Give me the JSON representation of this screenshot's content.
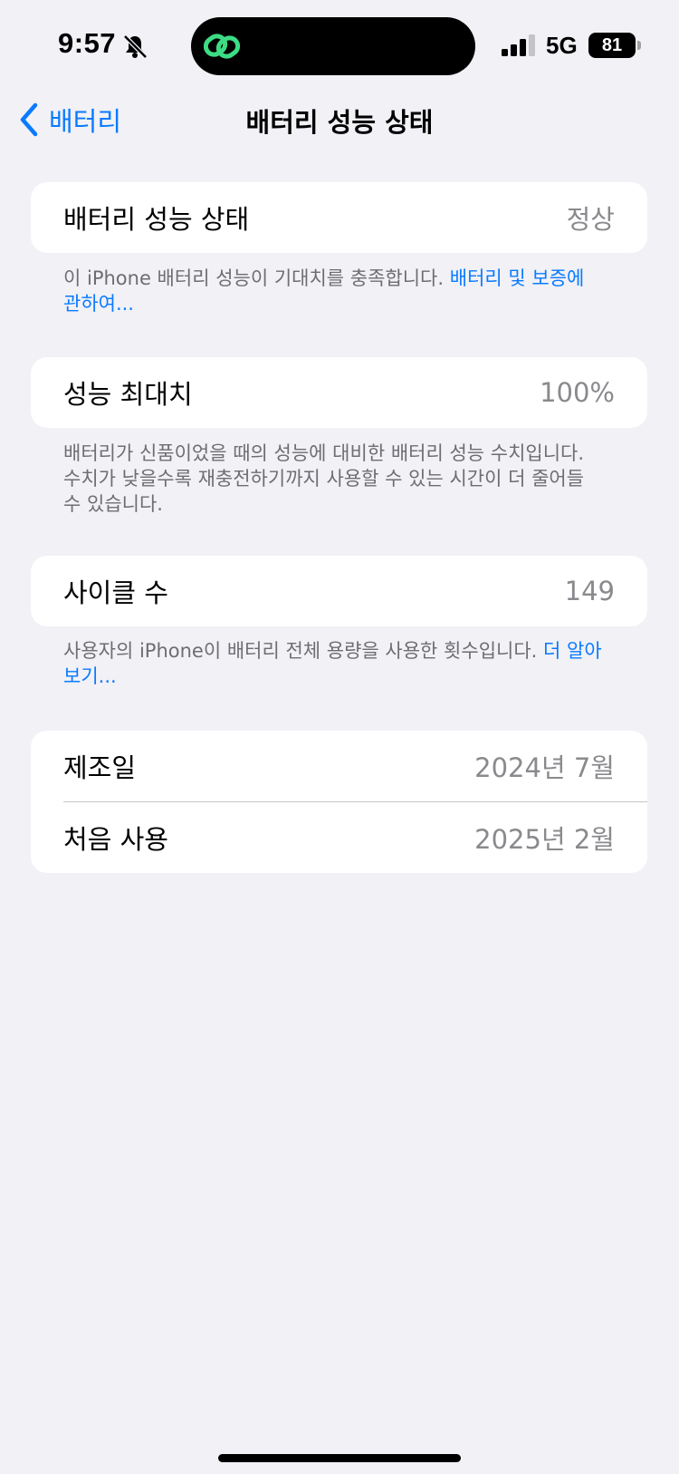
{
  "status_bar": {
    "time": "9:57",
    "network": "5G",
    "battery_percent": "81",
    "icons": [
      "bell-slash-icon",
      "link-icon",
      "signal-icon",
      "battery-icon"
    ]
  },
  "nav": {
    "back_label": "배터리",
    "title": "배터리 성능 상태"
  },
  "sections": {
    "health": {
      "label": "배터리 성능 상태",
      "value": "정상",
      "footnote": "이 iPhone 배터리 성능이 기대치를 충족합니다.",
      "footnote_link": "배터리 및 보증에 관하여..."
    },
    "max_capacity": {
      "label": "성능 최대치",
      "value": "100%",
      "footnote": "배터리가 신품이었을 때의 성능에 대비한 배터리 성능 수치입니다. 수치가 낮을수록 재충전하기까지 사용할 수 있는 시간이 더 줄어들 수 있습니다."
    },
    "cycle_count": {
      "label": "사이클 수",
      "value": "149",
      "footnote": "사용자의 iPhone이 배터리 전체 용량을 사용한 횟수입니다.",
      "footnote_link": "더 알아보기..."
    },
    "dates": {
      "manufacture_label": "제조일",
      "manufacture_value": "2024년 7월",
      "first_use_label": "처음 사용",
      "first_use_value": "2025년 2월"
    }
  },
  "colors": {
    "accent": "#0a7aff",
    "background": "#f1f1f6",
    "secondary_text": "#8a8a8e",
    "island_icon": "#3ddc84"
  }
}
